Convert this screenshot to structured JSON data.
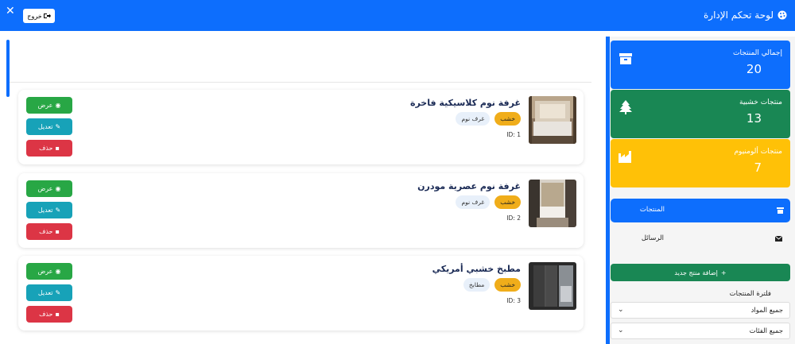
{
  "header": {
    "title": "لوحة تحكم الإدارة",
    "logout_label": "خروج",
    "close_symbol": "✕"
  },
  "stats": [
    {
      "label": "إجمالي المنتجات",
      "value": "20",
      "icon": "box-icon",
      "color": "#0d6efd"
    },
    {
      "label": "منتجات خشبية",
      "value": "13",
      "icon": "tree-icon",
      "color": "#198754"
    },
    {
      "label": "منتجات ألومنيوم",
      "value": "7",
      "icon": "factory-icon",
      "color": "#ffc107"
    }
  ],
  "nav": {
    "products_label": "المنتجات",
    "messages_label": "الرسائل"
  },
  "add_product_label": "إضافة منتج جديد",
  "filter": {
    "label": "فلترة المنتجات",
    "material_value": "جميع المواد",
    "category_value": "جميع الفئات"
  },
  "actions": {
    "view": "عرض",
    "edit": "تعديل",
    "delete": "حذف"
  },
  "products": [
    {
      "title": "غرفة نوم كلاسيكية فاخرة",
      "material": "خشب",
      "category": "غرف نوم",
      "id": "ID: 1"
    },
    {
      "title": "غرفة نوم عصرية مودرن",
      "material": "خشب",
      "category": "غرف نوم",
      "id": "ID: 2"
    },
    {
      "title": "مطبخ خشبي أمريكي",
      "material": "خشب",
      "category": "مطابخ",
      "id": "ID: 3"
    }
  ],
  "colors": {
    "primary": "#0d6efd",
    "success": "#198754",
    "warning": "#ffc107",
    "info": "#17a2b8",
    "danger": "#dc3545"
  }
}
